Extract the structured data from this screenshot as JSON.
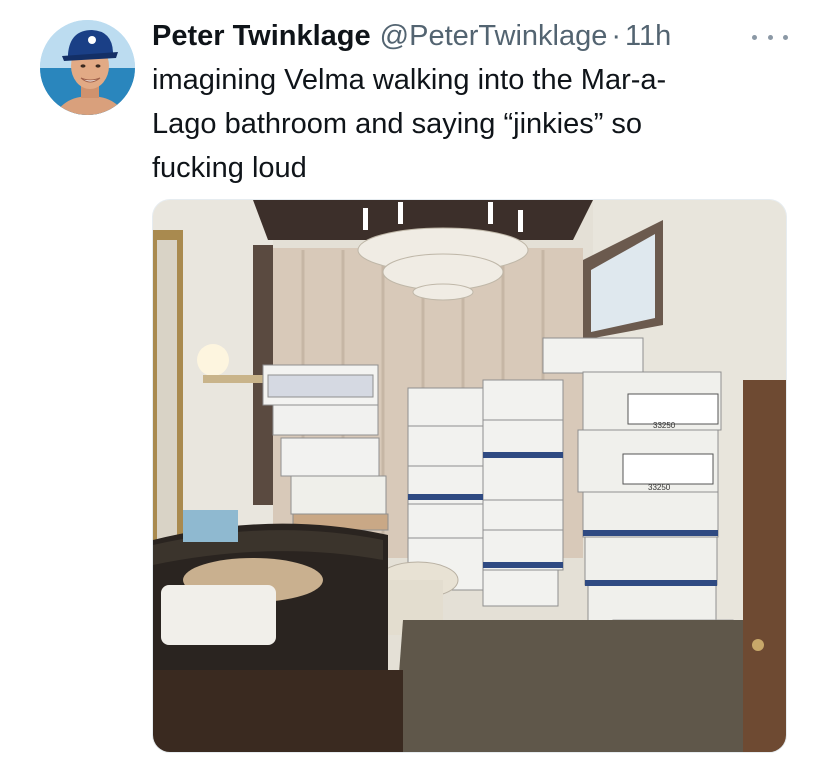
{
  "tweet": {
    "author_name": "Peter Twinklage",
    "author_handle": "@PeterTwinklage",
    "separator": "·",
    "time_ago": "11h",
    "text": "imagining Velma walking into the Mar-a-\nLago bathroom and saying “jinkies” so\nfucking loud",
    "avatar_icon": "user-avatar-photo",
    "more_icon": "more-horizontal-icon"
  },
  "media": {
    "description_icon": "bathroom-photo",
    "box_label_1": "33250",
    "box_label_2": "33250"
  },
  "colors": {
    "primary_text": "#0f1419",
    "secondary_text": "#536471"
  }
}
